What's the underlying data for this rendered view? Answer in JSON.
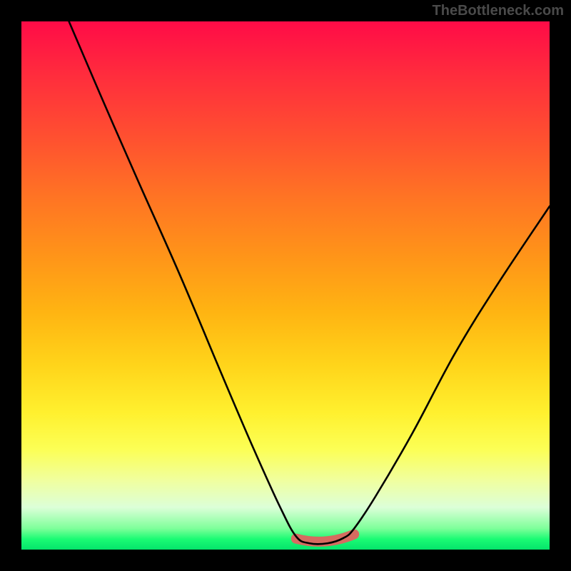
{
  "watermark": "TheBottleneck.com",
  "chart_data": {
    "type": "line",
    "title": "",
    "xlabel": "",
    "ylabel": "",
    "xlim": [
      0,
      100
    ],
    "ylim": [
      0,
      100
    ],
    "series": [
      {
        "name": "bottleneck-curve",
        "x": [
          9,
          15,
          22,
          30,
          38,
          44,
          49,
          52,
          54.5,
          58,
          61,
          63,
          67,
          74,
          82,
          90,
          100
        ],
        "y": [
          100,
          86,
          70,
          52,
          33,
          19,
          8,
          2.5,
          1.2,
          1.2,
          2.2,
          4,
          10,
          22,
          37,
          50,
          65
        ]
      }
    ],
    "highlight_range_x": [
      52,
      63
    ],
    "highlight_y": 1.4,
    "gradient_stops": [
      {
        "pos": 0,
        "color": "#ff0b47"
      },
      {
        "pos": 10,
        "color": "#ff2c3d"
      },
      {
        "pos": 22,
        "color": "#ff5030"
      },
      {
        "pos": 33,
        "color": "#ff7324"
      },
      {
        "pos": 44,
        "color": "#ff9319"
      },
      {
        "pos": 55,
        "color": "#ffb412"
      },
      {
        "pos": 65,
        "color": "#ffd41a"
      },
      {
        "pos": 74,
        "color": "#fff02e"
      },
      {
        "pos": 81,
        "color": "#fcff55"
      },
      {
        "pos": 87,
        "color": "#f0ffa0"
      },
      {
        "pos": 92,
        "color": "#dcffd8"
      },
      {
        "pos": 96,
        "color": "#7eff9a"
      },
      {
        "pos": 98,
        "color": "#1bfb74"
      },
      {
        "pos": 100,
        "color": "#05e46b"
      }
    ]
  }
}
